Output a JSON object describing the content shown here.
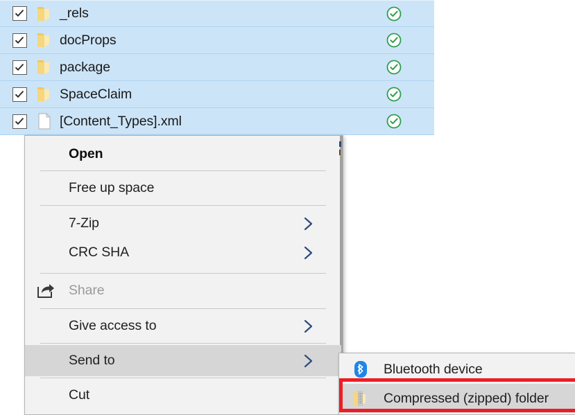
{
  "file_list": {
    "rows": [
      {
        "name": "_rels",
        "icon": "folder-icon",
        "checked": true,
        "status": "sync-complete-icon"
      },
      {
        "name": "docProps",
        "icon": "folder-icon",
        "checked": true,
        "status": "sync-complete-icon"
      },
      {
        "name": "package",
        "icon": "folder-icon",
        "checked": true,
        "status": "sync-complete-icon"
      },
      {
        "name": "SpaceClaim",
        "icon": "folder-icon",
        "checked": true,
        "status": "sync-complete-icon"
      },
      {
        "name": "[Content_Types].xml",
        "icon": "xml-file-icon",
        "checked": true,
        "status": "sync-complete-icon"
      }
    ],
    "selection_color": "#cce4f7",
    "status_color": "#2e9e4e"
  },
  "context_menu": {
    "items": [
      {
        "label": "Open",
        "bold": true,
        "disabled": false,
        "submenu": false,
        "icon": null,
        "highlighted": false
      },
      {
        "label": "Free up space",
        "bold": false,
        "disabled": false,
        "submenu": false,
        "icon": null,
        "highlighted": false
      },
      {
        "label": "7-Zip",
        "bold": false,
        "disabled": false,
        "submenu": true,
        "icon": null,
        "highlighted": false
      },
      {
        "label": "CRC SHA",
        "bold": false,
        "disabled": false,
        "submenu": true,
        "icon": null,
        "highlighted": false
      },
      {
        "label": "Share",
        "bold": false,
        "disabled": true,
        "submenu": false,
        "icon": "share-icon",
        "highlighted": false
      },
      {
        "label": "Give access to",
        "bold": false,
        "disabled": false,
        "submenu": true,
        "icon": null,
        "highlighted": false
      },
      {
        "label": "Send to",
        "bold": false,
        "disabled": false,
        "submenu": true,
        "icon": null,
        "highlighted": true
      },
      {
        "label": "Cut",
        "bold": false,
        "disabled": false,
        "submenu": false,
        "icon": null,
        "highlighted": false
      }
    ],
    "highlight_color": "#d6d6d6",
    "background_color": "#f2f2f2"
  },
  "submenu": {
    "parent": "Send to",
    "items": [
      {
        "label": "Bluetooth device",
        "icon": "bluetooth-icon",
        "highlighted": false
      },
      {
        "label": "Compressed (zipped) folder",
        "icon": "zipped-folder-icon",
        "highlighted": true
      }
    ]
  },
  "annotation": {
    "type": "red-rectangle-highlight",
    "target": "Compressed (zipped) folder",
    "color": "#ee1c25"
  }
}
